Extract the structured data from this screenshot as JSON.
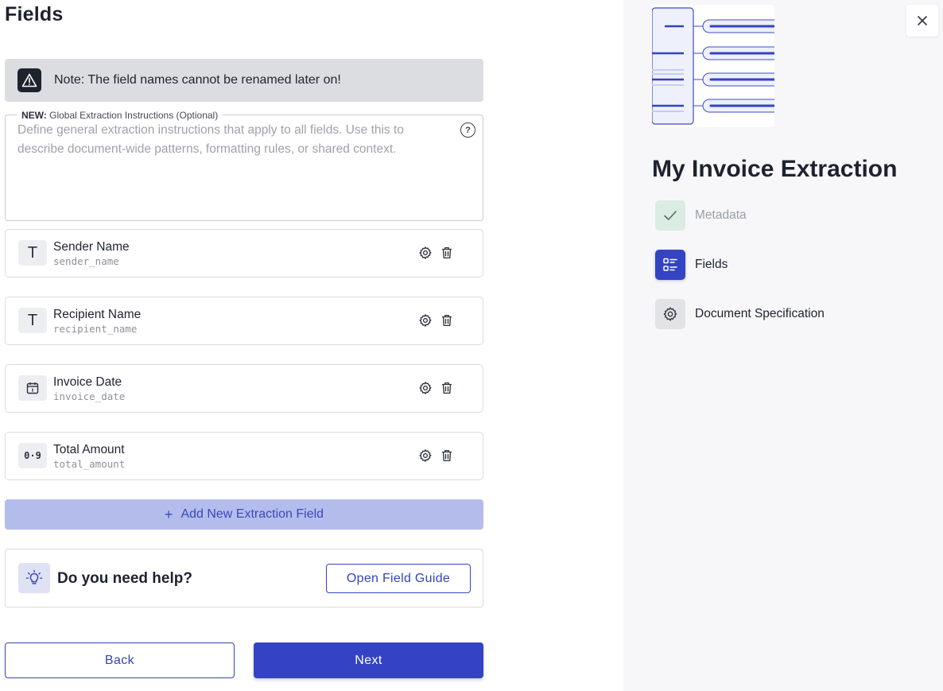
{
  "page": {
    "title": "Fields"
  },
  "note": {
    "text": "Note: The field names cannot be renamed later on!"
  },
  "global_instructions": {
    "legend_prefix": "NEW:",
    "legend_text": "Global Extraction Instructions (Optional)",
    "placeholder": "Define general extraction instructions that apply to all fields. Use this to describe document-wide patterns, formatting rules, or shared context.",
    "help_glyph": "?"
  },
  "fields": [
    {
      "label": "Sender Name",
      "key": "sender_name",
      "type_icon": "text-type-icon",
      "type_glyph": "T"
    },
    {
      "label": "Recipient Name",
      "key": "recipient_name",
      "type_icon": "text-type-icon",
      "type_glyph": "T"
    },
    {
      "label": "Invoice Date",
      "key": "invoice_date",
      "type_icon": "calendar-type-icon",
      "type_glyph": ""
    },
    {
      "label": "Total Amount",
      "key": "total_amount",
      "type_icon": "number-type-icon",
      "type_glyph": "0·9"
    }
  ],
  "add_field": {
    "label": "Add New Extraction Field",
    "icon": "+"
  },
  "help": {
    "title": "Do you need help?",
    "button": "Open Field Guide"
  },
  "footer": {
    "back": "Back",
    "next": "Next"
  },
  "sidebar": {
    "project_title": "My Invoice Extraction",
    "steps": [
      {
        "label": "Metadata",
        "icon": "check-icon",
        "state": "completed"
      },
      {
        "label": "Fields",
        "icon": "list-icon",
        "state": "active"
      },
      {
        "label": "Document Specification",
        "icon": "gear-icon",
        "state": "pending"
      }
    ]
  },
  "colors": {
    "primary": "#3343c3",
    "primary_light": "#b4bceb",
    "note_bg": "#dcdde1",
    "completed_bg": "#dbece2",
    "sidebar_bg": "#f7f7f9"
  }
}
